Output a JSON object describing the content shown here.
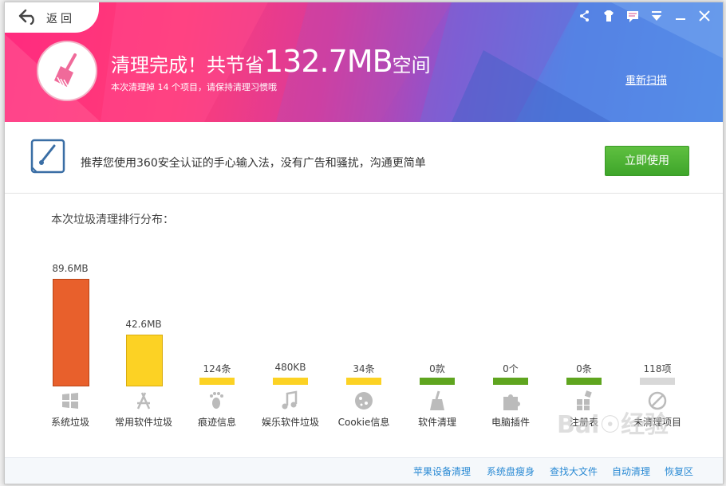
{
  "header": {
    "back_label": "返回",
    "title_prefix": "清理完成！共节省",
    "title_amount": "132.7MB",
    "title_suffix": "空间",
    "subtitle": "本次清理掉 14 个项目，请保持清理习惯哦",
    "rescan_label": "重新扫描"
  },
  "window_controls": [
    "share-icon",
    "skin-icon",
    "feedback-icon",
    "menu-icon",
    "minimize-icon",
    "close-icon"
  ],
  "promo": {
    "text": "推荐您使用360安全认证的手心输入法，没有广告和骚扰，沟通更简单",
    "button_label": "立即使用"
  },
  "chart_data": {
    "type": "bar",
    "title": "本次垃圾清理排行分布：",
    "categories": [
      "系统垃圾",
      "常用软件垃圾",
      "痕迹信息",
      "娱乐软件垃圾",
      "Cookie信息",
      "软件清理",
      "电脑插件",
      "注册表",
      "未清理项目"
    ],
    "value_labels": [
      "89.6MB",
      "42.6MB",
      "124条",
      "480KB",
      "34条",
      "0款",
      "0个",
      "0条",
      "118项"
    ],
    "values_mb": [
      89.6,
      42.6,
      null,
      0.47,
      null,
      0,
      0,
      0,
      null
    ],
    "icons": [
      "windows-icon",
      "app-store-icon",
      "footprint-icon",
      "music-icon",
      "cookie-icon",
      "broom-icon",
      "puzzle-icon",
      "registry-icon",
      "forbidden-icon"
    ],
    "colors": [
      "#e8602c",
      "#fcd224",
      "#fcd224",
      "#fcd224",
      "#fcd224",
      "#5fa51f",
      "#5fa51f",
      "#5fa51f",
      "#d8d8d8"
    ]
  },
  "footer": {
    "links": [
      "苹果设备清理",
      "系统盘瘦身",
      "查找大文件",
      "自动清理",
      "恢复区"
    ]
  }
}
